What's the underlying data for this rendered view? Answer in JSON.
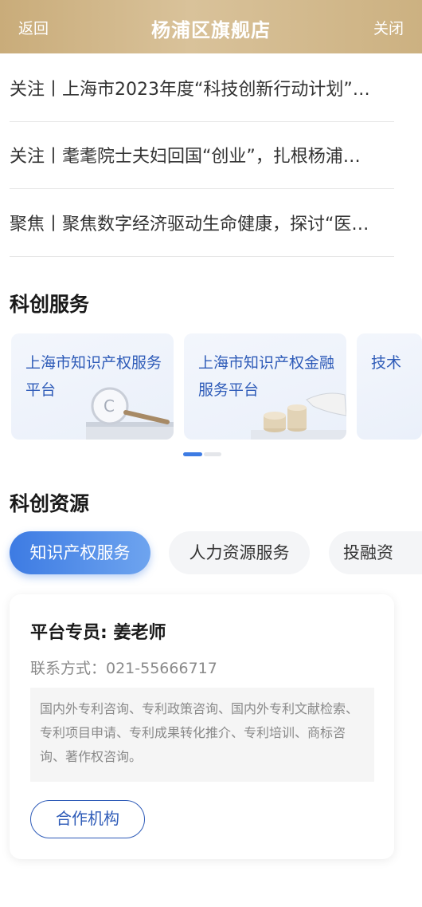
{
  "topbar": {
    "back": "返回",
    "title": "杨浦区旗舰店",
    "close": "关闭"
  },
  "news": [
    {
      "text": "关注丨上海市2023年度“科技创新行动计划”…"
    },
    {
      "text": "关注丨耄耄院士夫妇回国“创业”，扎根杨浦…"
    },
    {
      "text": "聚焦丨聚焦数字经济驱动生命健康，探讨“医…"
    }
  ],
  "services": {
    "title": "科创服务",
    "cards": [
      {
        "label": "上海市知识产权服务平台",
        "icon": "magnifier-icon"
      },
      {
        "label": "上海市知识产权金融服务平台",
        "icon": "coins-icon"
      },
      {
        "label": "技术"
      }
    ]
  },
  "resources": {
    "title": "科创资源",
    "tabs": [
      {
        "label": "知识产权服务"
      },
      {
        "label": "人力资源服务"
      },
      {
        "label": "投融资"
      }
    ],
    "card": {
      "name": "平台专员: 姜老师",
      "phone": "联系方式：021-55666717",
      "description": "国内外专利咨询、专利政策咨询、国内外专利文献检索、专利项目申请、专利成果转化推介、专利培训、商标咨询、著作权咨询。",
      "button": "合作机构"
    }
  },
  "colors": {
    "accent": "#3d7be3",
    "gold": "#c9ac7a",
    "link_blue": "#2e5bb8"
  }
}
